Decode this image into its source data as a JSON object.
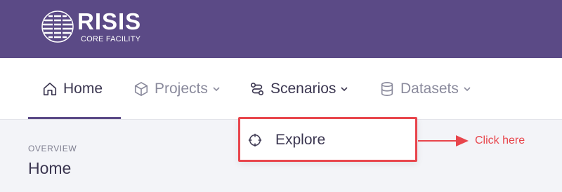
{
  "header": {
    "logo_word": "RISIS",
    "logo_sub": "CORE FACILITY",
    "brand_color": "#5b4a86"
  },
  "nav": {
    "items": [
      {
        "label": "Home",
        "icon": "home-icon",
        "active": true
      },
      {
        "label": "Projects",
        "icon": "cube-icon",
        "has_dropdown": true
      },
      {
        "label": "Scenarios",
        "icon": "route-icon",
        "has_dropdown": true
      },
      {
        "label": "Datasets",
        "icon": "database-icon",
        "has_dropdown": true
      }
    ]
  },
  "dropdown": {
    "items": [
      {
        "label": "Explore",
        "icon": "crosshair-icon"
      }
    ],
    "highlight_color": "#e8454c"
  },
  "annotation": {
    "text": "Click here",
    "color": "#e8454c"
  },
  "page": {
    "overview_label": "OVERVIEW",
    "title": "Home"
  }
}
